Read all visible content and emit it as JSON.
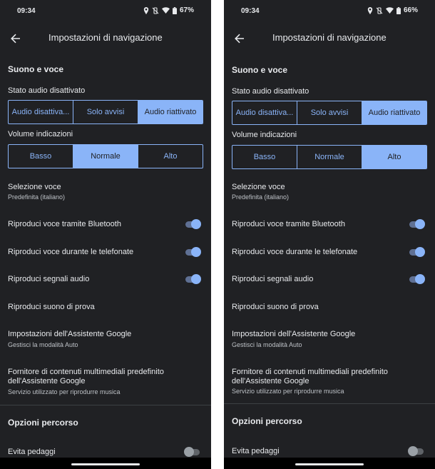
{
  "screens": [
    {
      "status": {
        "time": "09:34",
        "battery": "67%"
      },
      "app_bar": {
        "title": "Impostazioni di navigazione"
      },
      "sound_section": {
        "header": "Suono e voce",
        "audio_state_label": "Stato audio disattivato",
        "audio_state_options": [
          "Audio disattiva...",
          "Solo avvisi",
          "Audio riattivato"
        ],
        "audio_state_selected": "Audio riattivato",
        "volume_label": "Volume indicazioni",
        "volume_options": [
          "Basso",
          "Normale",
          "Alto"
        ],
        "volume_selected": "Normale",
        "voice_selection": {
          "title": "Selezione voce",
          "subtitle": "Predefinita (italiano)"
        },
        "bluetooth": {
          "label": "Riproduci voce tramite Bluetooth",
          "enabled": true
        },
        "during_calls": {
          "label": "Riproduci voce durante le telefonate",
          "enabled": true
        },
        "audio_cues": {
          "label": "Riproduci segnali audio",
          "enabled": true
        },
        "test_sound": {
          "label": "Riproduci suono di prova"
        },
        "assistant_settings": {
          "title": "Impostazioni dell'Assistente Google",
          "subtitle": "Gestisci la modalità Auto"
        },
        "media_provider": {
          "title": "Fornitore di contenuti multimediali predefinito dell'Assistente Google",
          "subtitle": "Servizio utilizzato per riprodurre musica"
        }
      },
      "route_section": {
        "header": "Opzioni percorso",
        "avoid_tolls": {
          "label": "Evita pedaggi",
          "enabled": false
        }
      }
    },
    {
      "status": {
        "time": "09:34",
        "battery": "66%"
      },
      "app_bar": {
        "title": "Impostazioni di navigazione"
      },
      "sound_section": {
        "header": "Suono e voce",
        "audio_state_label": "Stato audio disattivato",
        "audio_state_options": [
          "Audio disattiva...",
          "Solo avvisi",
          "Audio riattivato"
        ],
        "audio_state_selected": "Audio riattivato",
        "volume_label": "Volume indicazioni",
        "volume_options": [
          "Basso",
          "Normale",
          "Alto"
        ],
        "volume_selected": "Alto",
        "voice_selection": {
          "title": "Selezione voce",
          "subtitle": "Predefinita (italiano)"
        },
        "bluetooth": {
          "label": "Riproduci voce tramite Bluetooth",
          "enabled": true
        },
        "during_calls": {
          "label": "Riproduci voce durante le telefonate",
          "enabled": true
        },
        "audio_cues": {
          "label": "Riproduci segnali audio",
          "enabled": true
        },
        "test_sound": {
          "label": "Riproduci suono di prova"
        },
        "assistant_settings": {
          "title": "Impostazioni dell'Assistente Google",
          "subtitle": "Gestisci la modalità Auto"
        },
        "media_provider": {
          "title": "Fornitore di contenuti multimediali predefinito dell'Assistente Google",
          "subtitle": "Servizio utilizzato per riprodurre musica"
        }
      },
      "route_section": {
        "header": "Opzioni percorso",
        "avoid_tolls": {
          "label": "Evita pedaggi",
          "enabled": false
        }
      }
    }
  ],
  "icons": {
    "location": "location-icon",
    "vibrate_off": "vibrate-off-icon",
    "wifi": "wifi-icon",
    "battery": "battery-icon",
    "back": "back-arrow-icon"
  },
  "colors": {
    "background": "#202124",
    "accent": "#8ab4f8",
    "text": "#e8eaed",
    "secondary_text": "#bdc1c6",
    "divider": "#3c4043"
  }
}
